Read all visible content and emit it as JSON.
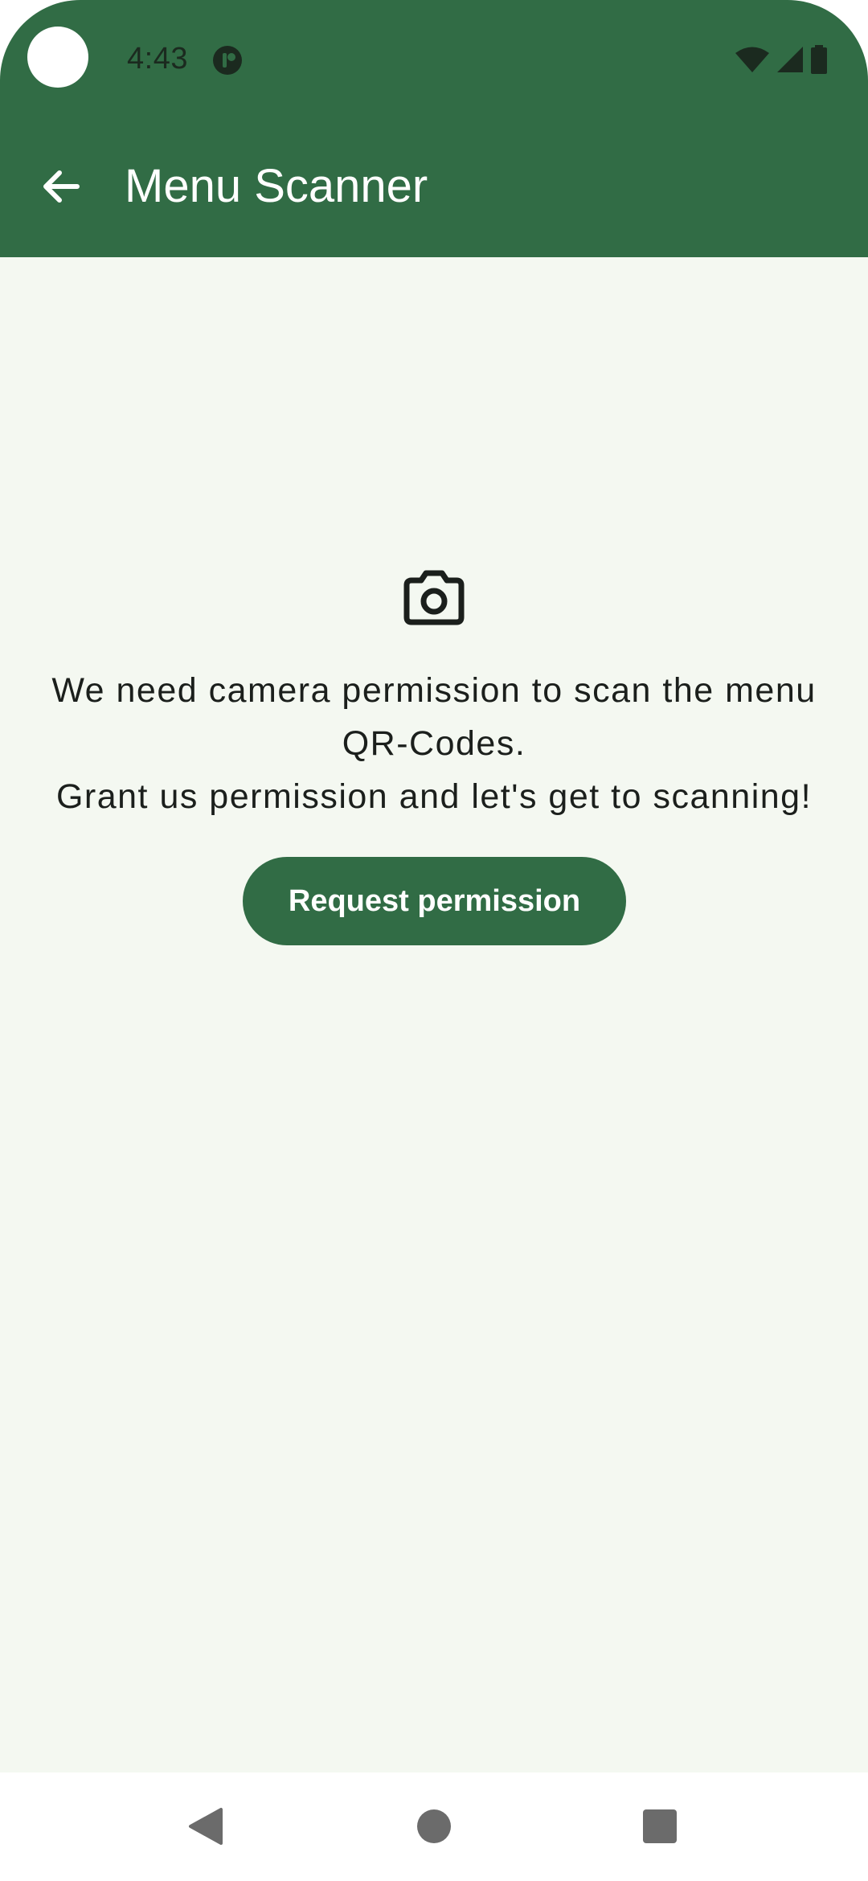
{
  "status_bar": {
    "time": "4:43",
    "app_notification_icon": "app-badge-icon",
    "wifi_icon": "wifi-icon",
    "signal_icon": "cell-signal-icon",
    "battery_icon": "battery-icon"
  },
  "app_bar": {
    "title": "Menu Scanner",
    "back_icon": "arrow-back-icon"
  },
  "permission": {
    "icon": "camera-icon",
    "message_line1": "We need camera permission to scan the menu QR-Codes.",
    "message_line2": "Grant us permission and let's get to scanning!",
    "button_label": "Request permission"
  },
  "nav_bar": {
    "back": "nav-back-icon",
    "home": "nav-home-icon",
    "recents": "nav-recents-icon"
  },
  "colors": {
    "primary": "#316c45",
    "background": "#f4f8f1",
    "on_primary": "#ffffff",
    "text": "#1b1f1c",
    "nav_icon": "#6b6b6b"
  }
}
